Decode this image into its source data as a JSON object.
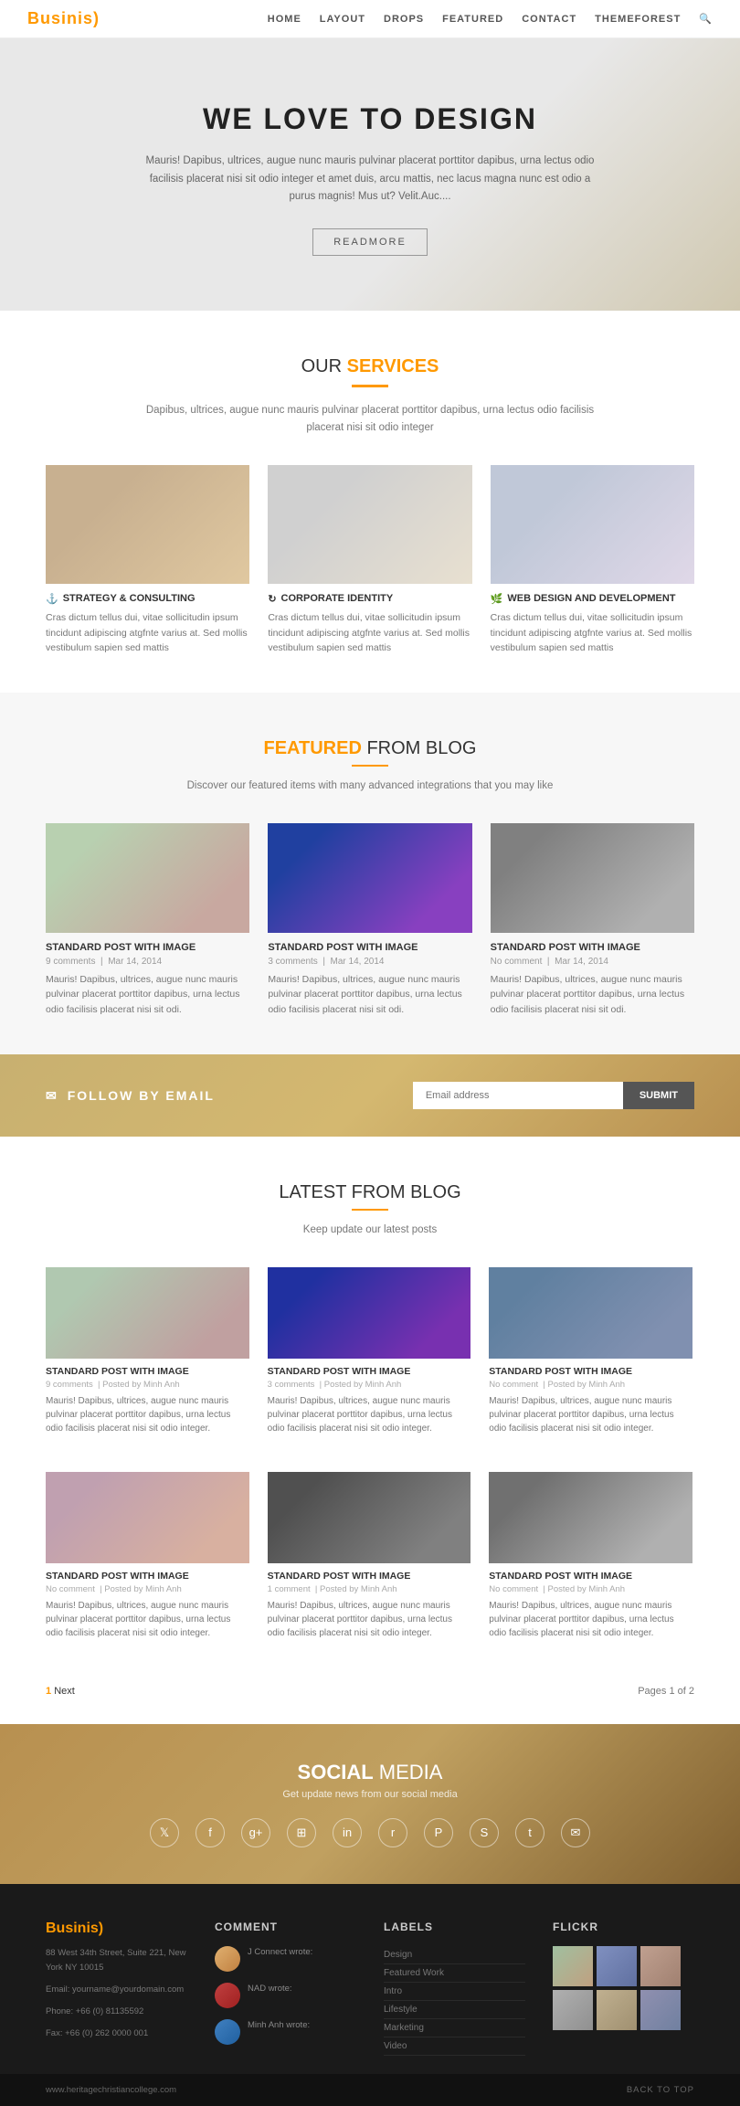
{
  "navbar": {
    "logo": "Businis",
    "logo_accent": ")",
    "links": [
      "HOME",
      "LAYOUT",
      "DROPS",
      "FEATURED",
      "CONTACT",
      "THEMEFOREST"
    ]
  },
  "hero": {
    "heading": "WE LOVE TO DESIGN",
    "description": "Mauris! Dapibus, ultrices, augue nunc mauris pulvinar placerat porttitor dapibus, urna lectus odio facilisis placerat nisi sit odio integer et amet duis, arcu mattis, nec lacus magna nunc est odio a purus magnis! Mus ut? Velit.Auc....",
    "button_label": "READMORE"
  },
  "services": {
    "section_pre": "OUR",
    "section_title": "SERVICES",
    "description": "Dapibus, ultrices, augue nunc mauris pulvinar placerat porttitor dapibus, urna lectus odio facilisis placerat nisi sit odio integer",
    "items": [
      {
        "title": "STRATEGY & CONSULTING",
        "icon": "anchor",
        "text": "Cras dictum tellus dui, vitae sollicitudin ipsum tincidunt adipiscing atgfnte varius at. Sed mollis vestibulum sapien sed mattis"
      },
      {
        "title": "CORPORATE IDENTITY",
        "icon": "refresh",
        "text": "Cras dictum tellus dui, vitae sollicitudin ipsum tincidunt adipiscing atgfnte varius at. Sed mollis vestibulum sapien sed mattis"
      },
      {
        "title": "WEB DESIGN AND DEVELOPMENT",
        "icon": "leaf",
        "text": "Cras dictum tellus dui, vitae sollicitudin ipsum tincidunt adipiscing atgfnte varius at. Sed mollis vestibulum sapien sed mattis"
      }
    ]
  },
  "featured_blog": {
    "section_pre": "FEATURED",
    "section_after": "FROM BLOG",
    "description": "Discover our featured items with many advanced integrations that you may like",
    "posts": [
      {
        "title": "STANDARD POST WITH IMAGE",
        "comments": "9 comments",
        "date": "Mar 14, 2014",
        "excerpt": "Mauris! Dapibus, ultrices, augue nunc mauris pulvinar placerat porttitor dapibus, urna lectus odio facilisis placerat nisi sit odi."
      },
      {
        "title": "STANDARD POST WITH IMAGE",
        "comments": "3 comments",
        "date": "Mar 14, 2014",
        "excerpt": "Mauris! Dapibus, ultrices, augue nunc mauris pulvinar placerat porttitor dapibus, urna lectus odio facilisis placerat nisi sit odi."
      },
      {
        "title": "STANDARD POST WITH IMAGE",
        "comments": "No comment",
        "date": "Mar 14, 2014",
        "excerpt": "Mauris! Dapibus, ultrices, augue nunc mauris pulvinar placerat porttitor dapibus, urna lectus odio facilisis placerat nisi sit odi."
      }
    ]
  },
  "follow": {
    "label": "FOLLOW BY EMAIL",
    "input_placeholder": "Email address",
    "button_label": "Submit"
  },
  "latest_blog": {
    "section_pre": "LATEST",
    "section_after": "FROM BLOG",
    "description": "Keep update our latest posts",
    "posts": [
      {
        "title": "STANDARD POST WITH IMAGE",
        "comments": "9 comments",
        "author": "Minh Anh",
        "excerpt": "Mauris! Dapibus, ultrices, augue nunc mauris pulvinar placerat porttitor dapibus, urna lectus odio facilisis placerat nisi sit odio integer."
      },
      {
        "title": "STANDARD POST WITH IMAGE",
        "comments": "3 comments",
        "author": "Minh Anh",
        "excerpt": "Mauris! Dapibus, ultrices, augue nunc mauris pulvinar placerat porttitor dapibus, urna lectus odio facilisis placerat nisi sit odio integer."
      },
      {
        "title": "STANDARD POST WITH IMAGE",
        "comments": "No comment",
        "author": "Minh Anh",
        "excerpt": "Mauris! Dapibus, ultrices, augue nunc mauris pulvinar placerat porttitor dapibus, urna lectus odio facilisis placerat nisi sit odio integer."
      },
      {
        "title": "STANDARD POST WITH IMAGE",
        "comments": "No comment",
        "author": "Minh Anh",
        "excerpt": "Mauris! Dapibus, ultrices, augue nunc mauris pulvinar placerat porttitor dapibus, urna lectus odio facilisis placerat nisi sit odio integer."
      },
      {
        "title": "STANDARD POST WITH IMAGE",
        "comments": "1 comment",
        "author": "Minh Anh",
        "excerpt": "Mauris! Dapibus, ultrices, augue nunc mauris pulvinar placerat porttitor dapibus, urna lectus odio facilisis placerat nisi sit odio integer."
      },
      {
        "title": "STANDARD POST WITH IMAGE",
        "comments": "No comment",
        "author": "Minh Anh",
        "excerpt": "Mauris! Dapibus, ultrices, augue nunc mauris pulvinar placerat porttitor dapibus, urna lectus odio facilisis placerat nisi sit odio integer."
      }
    ]
  },
  "pagination": {
    "page_label": "1",
    "next_label": "Next",
    "pages_label": "Pages 1 of 2"
  },
  "social": {
    "section_pre": "SOCIAL",
    "section_after": "MEDIA",
    "subtitle": "Get update news from our social media",
    "icons": [
      "twitter",
      "facebook",
      "google-plus",
      "rss",
      "linkedin",
      "reddit",
      "pinterest",
      "stumbleupon",
      "tumblr",
      "email"
    ]
  },
  "footer": {
    "logo": "Businis",
    "address": "88 West 34th Street, Suite 221, New York NY 10015",
    "email": "Email: yourname@yourdomain.com",
    "phone": "Phone: +66 (0) 81135592",
    "fax": "Fax: +66 (0) 262 0000 001",
    "website": "www.heritagechristiancollege.com",
    "comment_title": "COMMENT",
    "comments": [
      {
        "author": "J Connect wrote:",
        "avatar_class": "av1"
      },
      {
        "author": "NAD wrote:",
        "avatar_class": "av2"
      },
      {
        "author": "Minh Anh wrote:",
        "avatar_class": "av3"
      }
    ],
    "labels_title": "LABELS",
    "labels": [
      {
        "name": "Design",
        "count": ""
      },
      {
        "name": "Featured Work",
        "count": ""
      },
      {
        "name": "Intro",
        "count": ""
      },
      {
        "name": "Lifestyle",
        "count": ""
      },
      {
        "name": "Marketing",
        "count": ""
      },
      {
        "name": "Video",
        "count": ""
      }
    ],
    "flickr_title": "FLICKR",
    "back_to_top": "BACK TO TOP"
  }
}
